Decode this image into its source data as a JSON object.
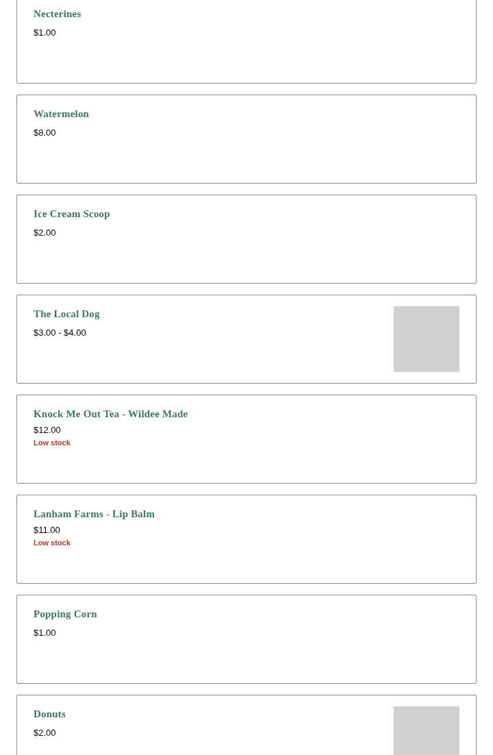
{
  "products": [
    {
      "name": "Necterines",
      "price": "$1.00",
      "has_image": false
    },
    {
      "name": "Watermelon",
      "price": "$8.00",
      "has_image": false
    },
    {
      "name": "Ice Cream Scoop",
      "price": "$2.00",
      "has_image": false
    },
    {
      "name": "The Local Dog",
      "price": "$3.00 - $4.00",
      "has_image": true
    },
    {
      "name": "Knock Me Out Tea - Wildee Made",
      "price": "$12.00",
      "stock": "Low stock",
      "has_image": false
    },
    {
      "name": "Lanham Farms - Lip Balm",
      "price": "$11.00",
      "stock": "Low stock",
      "has_image": false
    },
    {
      "name": "Popping Corn",
      "price": "$1.00",
      "has_image": false
    },
    {
      "name": "Donuts",
      "price": "$2.00",
      "has_image": true
    }
  ]
}
